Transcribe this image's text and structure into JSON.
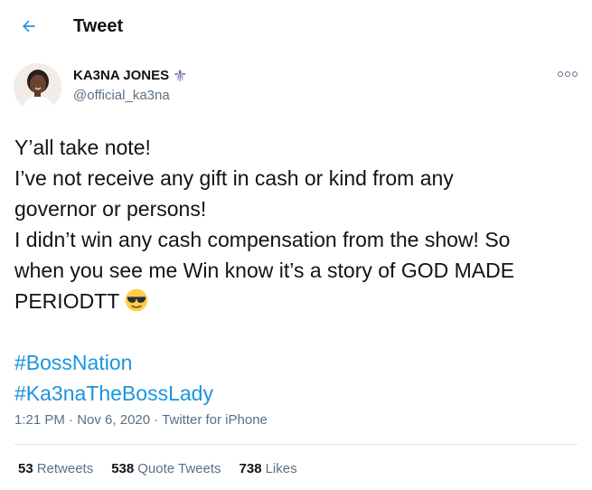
{
  "header": {
    "title": "Tweet",
    "back_icon": "arrow-left-icon"
  },
  "author": {
    "name": "KA3NA JONES",
    "emoji": "⚜",
    "handle": "@official_ka3na"
  },
  "tweet": {
    "lines": [
      "Y’all take note!",
      "I’ve not receive any gift in cash or kind from any",
      "governor or persons!",
      "I didn’t win any cash compensation from the show! So",
      "when you see me Win know it’s a story of GOD MADE",
      "PERIODTT"
    ],
    "hashtags": [
      "#BossNation",
      "#Ka3naTheBossLady"
    ],
    "emoji": "smiling-face-with-sunglasses"
  },
  "meta": {
    "time": "1:21 PM",
    "sep1": " · ",
    "date": "Nov 6, 2020",
    "sep2": " · ",
    "source": "Twitter for iPhone"
  },
  "stats": {
    "retweets_count": "53",
    "retweets_label": "Retweets",
    "quotes_count": "538",
    "quotes_label": "Quote Tweets",
    "likes_count": "738",
    "likes_label": "Likes"
  },
  "colors": {
    "accent": "#1b95e0",
    "text": "#0f1419",
    "muted": "#5b7083",
    "divider": "#e1e8ed"
  }
}
